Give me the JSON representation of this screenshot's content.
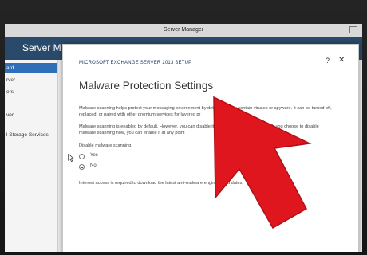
{
  "server_manager": {
    "window_title": "Server Manager",
    "header_title": "Server M",
    "nav_items": [
      {
        "label": "ard",
        "active": true
      },
      {
        "label": "rver",
        "active": false
      },
      {
        "label": "ers",
        "active": false
      },
      {
        "label": "ver",
        "active": false
      },
      {
        "label": "l Storage Services",
        "active": false
      }
    ]
  },
  "dialog": {
    "caption": "MICROSOFT EXCHANGE SERVER 2013 SETUP",
    "help_label": "?",
    "close_label": "✕",
    "heading": "Malware Protection Settings",
    "para1": "Malware scanning helps protect your messaging environment by detec                  that may contain viruses or spyware. It can be turned off, replaced, or paired with other premium services for layered pr",
    "para2": "Malware scanning is enabled by default. However, you can disable it if you           for malware scanning. If you choose to disable malware scanning now, you can enable it at any point",
    "disable_label": "Disable malware scanning.",
    "options": [
      {
        "label": "Yes",
        "checked": false
      },
      {
        "label": "No",
        "checked": true
      }
    ],
    "footer_note": "Internet access is required to download the latest anti-malware engine and d                  dates."
  },
  "overlay": {
    "arrow_color": "#e0161e"
  }
}
